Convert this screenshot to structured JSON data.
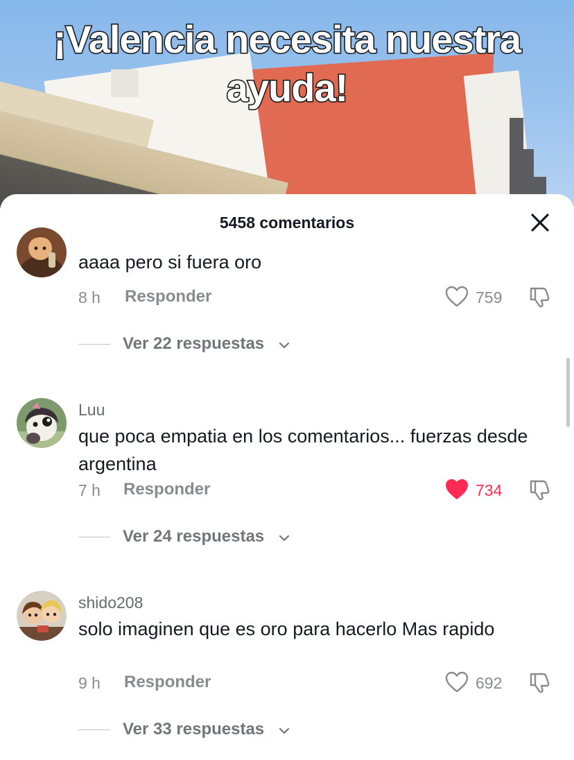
{
  "video": {
    "caption_line1": "¡Valencia necesita nuestra",
    "caption_line2": "ayuda!"
  },
  "sheet": {
    "title": "5458 comentarios",
    "close_icon": "close-icon"
  },
  "comments": [
    {
      "username": "",
      "text": "aaaa pero si fuera oro",
      "time": "8 h",
      "reply_label": "Responder",
      "likes": "759",
      "liked": false,
      "replies_label": "Ver 22 respuestas"
    },
    {
      "username": "Luu",
      "text": "que poca empatia en los comentarios... fuerzas desde argentina",
      "time": "7 h",
      "reply_label": "Responder",
      "likes": "734",
      "liked": true,
      "replies_label": "Ver 24 respuestas"
    },
    {
      "username": "shido208",
      "text": "solo imaginen que es oro para hacerlo Mas rapido",
      "time": "9 h",
      "reply_label": "Responder",
      "likes": "692",
      "liked": false,
      "replies_label": "Ver 33 respuestas"
    }
  ],
  "colors": {
    "like_active": "#fe2c55",
    "text_primary": "#161823",
    "text_secondary": "#8a8b91"
  },
  "icons": [
    "heart-icon",
    "heart-filled-icon",
    "dislike-icon",
    "chevron-down-icon",
    "close-icon"
  ]
}
